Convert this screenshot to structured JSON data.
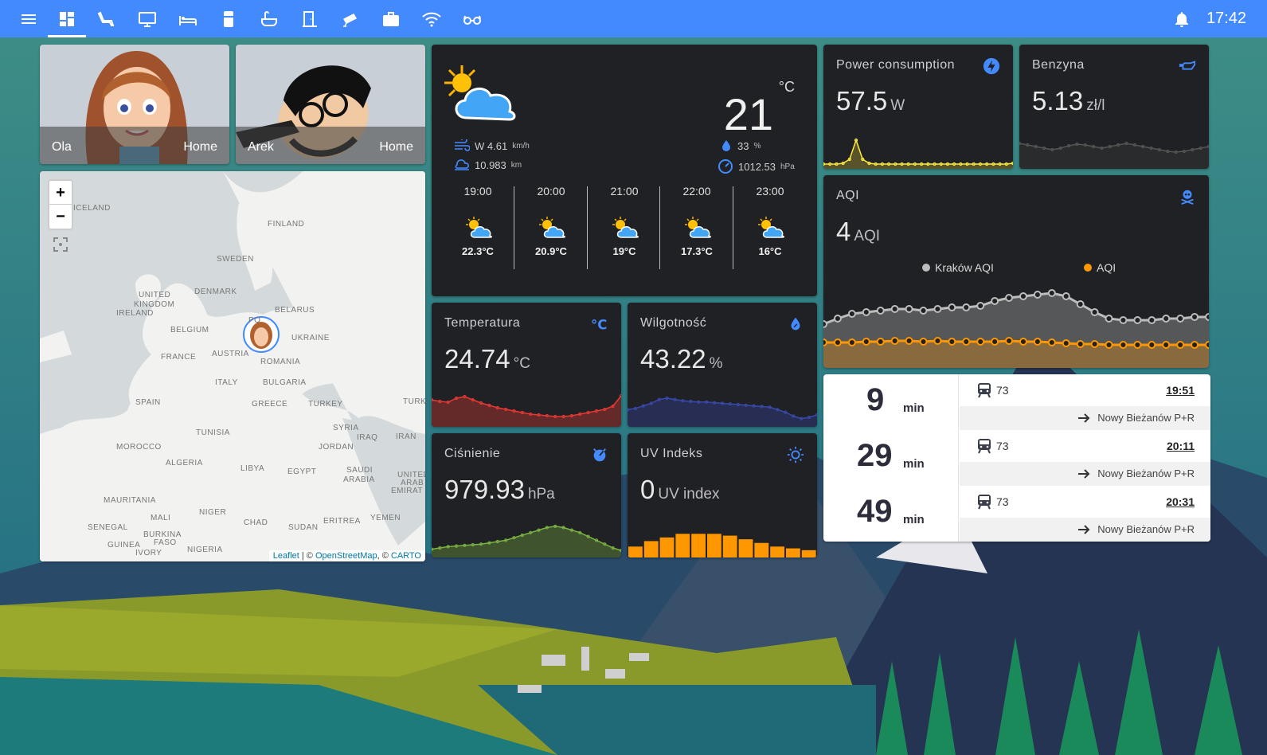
{
  "topbar": {
    "time": "17:42",
    "icons": [
      "menu-icon",
      "dashboard-icon",
      "lounge-chair-icon",
      "monitor-icon",
      "bed-icon",
      "fridge-icon",
      "bathtub-icon",
      "door-icon",
      "cctv-icon",
      "briefcase-icon",
      "wifi-icon",
      "glasses-icon"
    ],
    "accent": "#448aff"
  },
  "persons": [
    {
      "name": "Ola",
      "state": "Home"
    },
    {
      "name": "Arek",
      "state": "Home"
    }
  ],
  "map": {
    "labels": [
      "ICELAND",
      "FINLAND",
      "SWEDEN",
      "DENMARK",
      "UNITED",
      "KINGDOM",
      "IRELAND",
      "BELARUS",
      "BELGIUM",
      "UKRAINE",
      "FRANCE",
      "AUSTRIA",
      "ROMANIA",
      "ITALY",
      "BULGARIA",
      "SPAIN",
      "GREECE",
      "TURKEY",
      "TURK",
      "TUNISIA",
      "SYRIA",
      "IRAQ",
      "IRAN",
      "MOROCCO",
      "JORDAN",
      "ALGERIA",
      "LIBYA",
      "EGYPT",
      "SAUDI",
      "ARABIA",
      "UNITED",
      "ARAB",
      "EMIRAT",
      "MAURITANIA",
      "NIGER",
      "MALI",
      "CHAD",
      "SUDAN",
      "ERITREA",
      "YEMEN",
      "SENEGAL",
      "BURKINA",
      "FASO",
      "GUINEA",
      "IVORY",
      "NIGERIA",
      "PO"
    ],
    "zoom_in": "+",
    "zoom_out": "−",
    "attribution": {
      "leaflet": "Leaflet",
      "sep1": " | © ",
      "osm": "OpenStreetMap",
      "sep2": ", © ",
      "carto": "CARTO"
    }
  },
  "weather": {
    "temperature": "21",
    "unit": "°C",
    "wind": "W 4.61",
    "wind_unit": "km/h",
    "visibility": "10.983",
    "visibility_unit": "km",
    "humidity": "33",
    "humidity_unit": "%",
    "pressure": "1012.53",
    "pressure_unit": "hPa",
    "forecast": [
      {
        "time": "19:00",
        "temp": "22.3°C"
      },
      {
        "time": "20:00",
        "temp": "20.9°C"
      },
      {
        "time": "21:00",
        "temp": "19°C"
      },
      {
        "time": "22:00",
        "temp": "17.3°C"
      },
      {
        "time": "23:00",
        "temp": "16°C"
      }
    ]
  },
  "sensors": {
    "temperature": {
      "title": "Temperatura",
      "value": "24.74",
      "unit": "°C",
      "color": "#e53935"
    },
    "humidity": {
      "title": "Wilgotność",
      "value": "43.22",
      "unit": "%",
      "color": "#3949ab"
    },
    "pressure": {
      "title": "Ciśnienie",
      "value": "979.93",
      "unit": "hPa",
      "color": "#7cb342"
    },
    "uv": {
      "title": "UV Indeks",
      "value": "0",
      "unit": "UV index",
      "color": "#ff9800"
    },
    "power": {
      "title": "Power consumption",
      "value": "57.5",
      "unit": "W",
      "color": "#ffeb3b"
    },
    "fuel": {
      "title": "Benzyna",
      "value": "5.13",
      "unit": "zł/l",
      "color": "#666666"
    },
    "aqi": {
      "title": "AQI",
      "value": "4",
      "unit": "AQI",
      "legend": [
        "Kraków AQI",
        "AQI"
      ],
      "colors": [
        "#bdbdbd",
        "#ff9800"
      ]
    }
  },
  "transit": [
    {
      "minutes": "9",
      "min_label": "min",
      "line": "73",
      "time": "19:51",
      "dest": "Nowy Bieżanów P+R"
    },
    {
      "minutes": "29",
      "min_label": "min",
      "line": "73",
      "time": "20:11",
      "dest": "Nowy Bieżanów P+R"
    },
    {
      "minutes": "49",
      "min_label": "min",
      "line": "73",
      "time": "20:31",
      "dest": "Nowy Bieżanów P+R"
    }
  ]
}
